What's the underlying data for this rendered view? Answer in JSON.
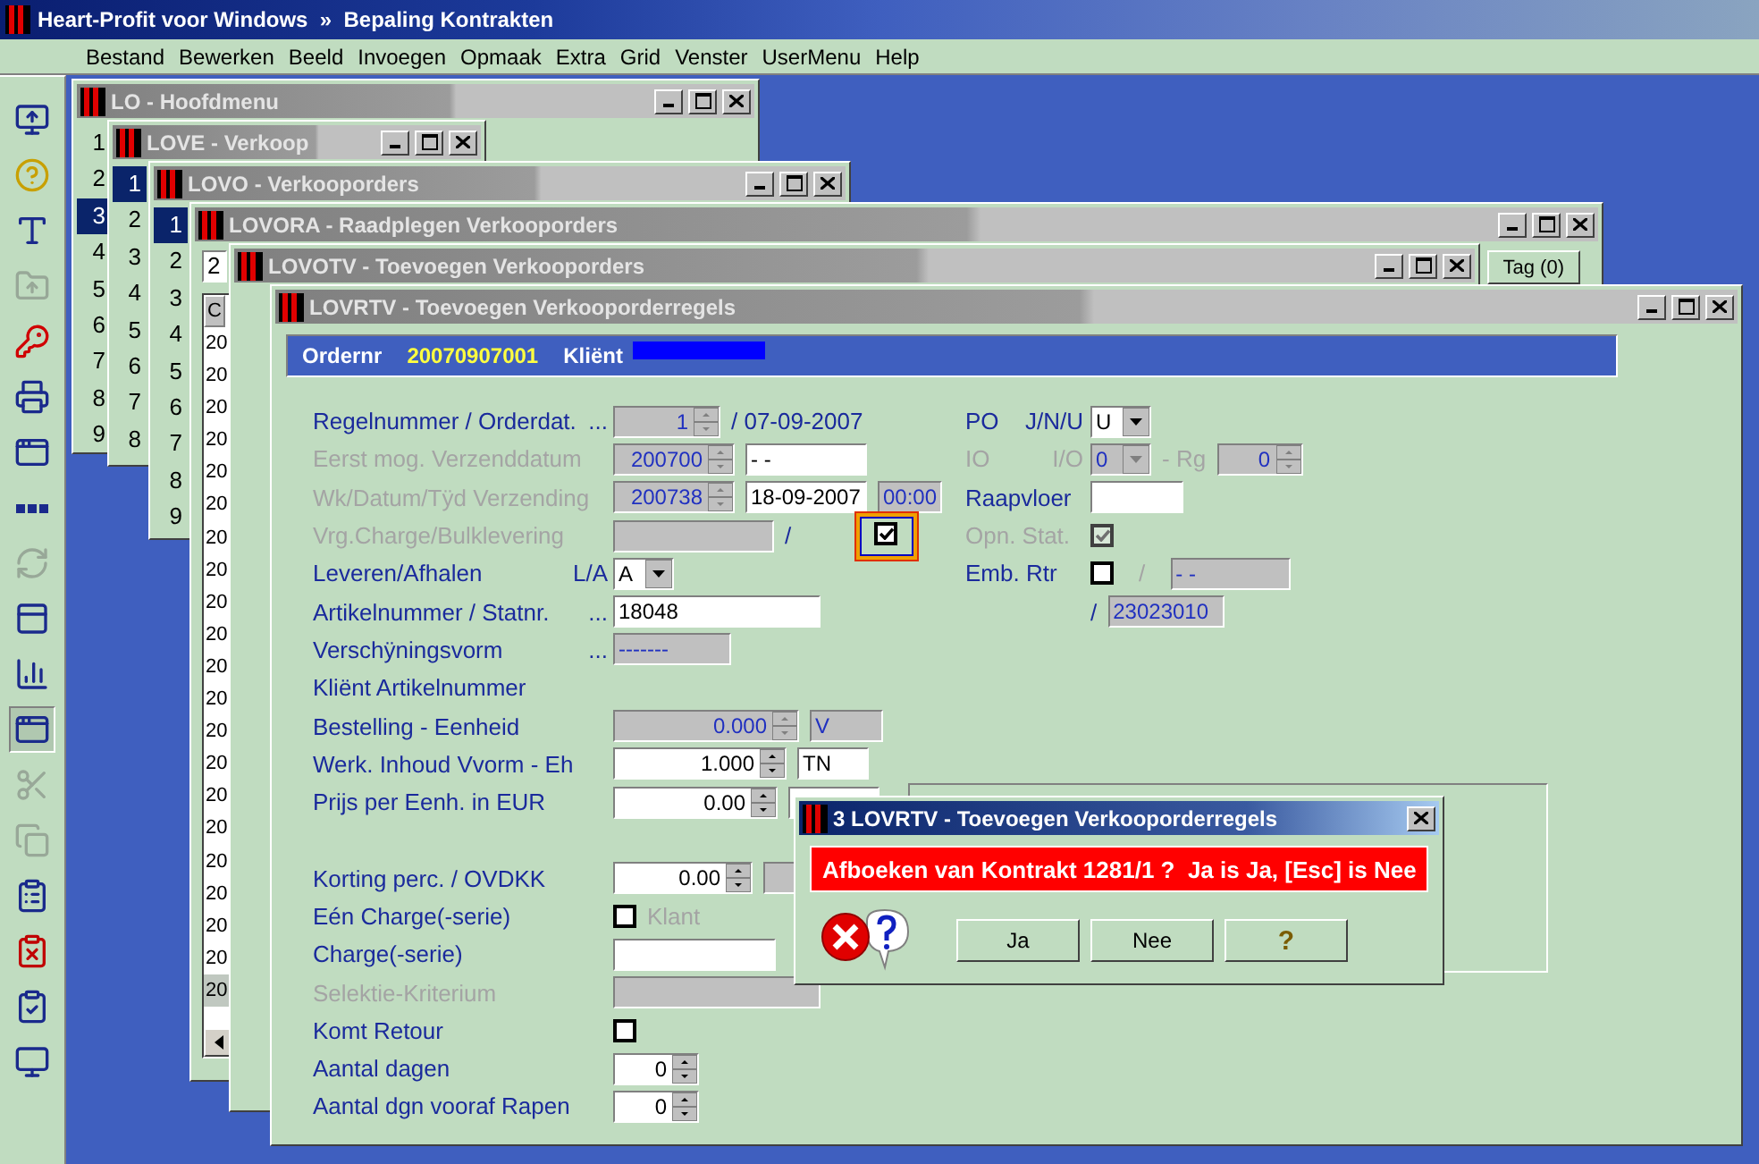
{
  "app_title": "Heart-Profit voor Windows  »  Bepaling Kontrakten",
  "menu": [
    "Bestand",
    "Bewerken",
    "Beeld",
    "Invoegen",
    "Opmaak",
    "Extra",
    "Grid",
    "Venster",
    "UserMenu",
    "Help"
  ],
  "toolbar": [
    {
      "disabled": false,
      "pressed": false
    },
    {
      "disabled": false,
      "pressed": false
    },
    {
      "disabled": false,
      "pressed": false
    },
    {
      "disabled": true,
      "pressed": false
    },
    {
      "disabled": false,
      "pressed": false
    },
    {
      "disabled": false,
      "pressed": false
    },
    {
      "disabled": false,
      "pressed": false
    },
    {
      "disabled": false,
      "pressed": false
    },
    {
      "disabled": true,
      "pressed": false
    },
    {
      "disabled": false,
      "pressed": false
    },
    {
      "disabled": false,
      "pressed": false
    },
    {
      "disabled": false,
      "pressed": true
    },
    {
      "disabled": true,
      "pressed": false
    },
    {
      "disabled": true,
      "pressed": false
    },
    {
      "disabled": false,
      "pressed": false
    },
    {
      "disabled": false,
      "pressed": false
    },
    {
      "disabled": false,
      "pressed": false
    },
    {
      "disabled": false,
      "pressed": false
    }
  ],
  "windows": [
    {
      "kind": "menu",
      "title": "LO - Hoofdmenu",
      "items": [
        {
          "label": "1",
          "selected": false
        },
        {
          "label": "2",
          "selected": false
        },
        {
          "label": "3",
          "selected": true
        },
        {
          "label": "4",
          "selected": false
        },
        {
          "label": "5",
          "selected": false
        },
        {
          "label": "6",
          "selected": false
        },
        {
          "label": "7",
          "selected": false
        },
        {
          "label": "8",
          "selected": false
        },
        {
          "label": "9",
          "selected": false
        }
      ]
    },
    {
      "kind": "menu",
      "title": "LOVE - Verkoop",
      "items": [
        {
          "label": "1",
          "selected": true
        },
        {
          "label": "2",
          "selected": false
        },
        {
          "label": "3",
          "selected": false
        },
        {
          "label": "4",
          "selected": false
        },
        {
          "label": "5",
          "selected": false
        },
        {
          "label": "6",
          "selected": false
        },
        {
          "label": "7",
          "selected": false
        },
        {
          "label": "8",
          "selected": false
        }
      ]
    },
    {
      "kind": "menu",
      "title": "LOVO - Verkooporders",
      "items": [
        {
          "label": "1",
          "selected": true
        },
        {
          "label": "2",
          "selected": false
        },
        {
          "label": "3",
          "selected": false
        },
        {
          "label": "4",
          "selected": false
        },
        {
          "label": "5",
          "selected": false
        },
        {
          "label": "6",
          "selected": false
        },
        {
          "label": "7",
          "selected": false
        },
        {
          "label": "8",
          "selected": false
        },
        {
          "label": "9",
          "selected": false
        }
      ]
    },
    {
      "kind": "browse",
      "title": "LOVORA - Raadplegen Verkooporders",
      "field": "2",
      "button": "Tag (0)",
      "column": "C",
      "rows": [
        {
          "value": "20",
          "selected": false
        },
        {
          "value": "20",
          "selected": false
        },
        {
          "value": "20",
          "selected": false
        },
        {
          "value": "20",
          "selected": false
        },
        {
          "value": "20",
          "selected": false
        },
        {
          "value": "20",
          "selected": false
        },
        {
          "value": "20",
          "selected": false
        },
        {
          "value": "20",
          "selected": false
        },
        {
          "value": "20",
          "selected": false
        },
        {
          "value": "20",
          "selected": false
        },
        {
          "value": "20",
          "selected": false
        },
        {
          "value": "20",
          "selected": false
        },
        {
          "value": "20",
          "selected": false
        },
        {
          "value": "20",
          "selected": false
        },
        {
          "value": "20",
          "selected": false
        },
        {
          "value": "20",
          "selected": false
        },
        {
          "value": "20",
          "selected": false
        },
        {
          "value": "20",
          "selected": false
        },
        {
          "value": "20",
          "selected": false
        },
        {
          "value": "20",
          "selected": false
        },
        {
          "value": "20",
          "selected": true
        }
      ]
    },
    {
      "kind": "blank",
      "title": "LOVOTV - Toevoegen Verkooporders"
    },
    {
      "kind": "form",
      "title": "LOVRTV - Toevoegen Verkooporderregels",
      "header": {
        "order_label": "Ordernr",
        "order_number": "20070907001",
        "client_label": "Kliënt"
      },
      "rows": [
        {
          "label": "Regelnummer / Orderdat.",
          "disabled": false,
          "suffix": "...",
          "controls": [
            {
              "kind": "spinner",
              "value": "1",
              "disabled": true
            },
            {
              "kind": "text",
              "value": "/ 07-09-2007",
              "disabled": false
            }
          ]
        },
        {
          "label": "Eerst mog. Verzenddatum",
          "disabled": true,
          "controls": [
            {
              "kind": "spinner",
              "value": "200700",
              "disabled": true
            },
            {
              "kind": "input",
              "value": "- -",
              "disabled": false
            }
          ]
        },
        {
          "label": "Wk/Datum/Tÿd Verzending",
          "disabled": true,
          "controls": [
            {
              "kind": "spinner",
              "value": "200738",
              "disabled": true
            },
            {
              "kind": "input",
              "value": "18-09-2007",
              "disabled": false
            },
            {
              "kind": "input",
              "value": "00:00",
              "disabled": true
            }
          ]
        },
        {
          "label": "Vrg.Charge/Bulklevering",
          "disabled": true,
          "controls": [
            {
              "kind": "input",
              "disabled": true
            },
            {
              "kind": "text",
              "value": "/",
              "disabled": false
            },
            {
              "kind": "checkbox",
              "checked": true,
              "disabled": false,
              "focused": true
            }
          ]
        },
        {
          "label": "Leveren/Afhalen",
          "disabled": false,
          "suffix": "L/A",
          "controls": [
            {
              "kind": "combo",
              "value": "A",
              "disabled": false
            }
          ]
        },
        {
          "label": "Artikelnummer / Statnr.",
          "disabled": false,
          "suffix": "...",
          "controls": [
            {
              "kind": "input",
              "value": "18048",
              "disabled": false
            }
          ]
        },
        {
          "label": "Verschÿningsvorm",
          "disabled": false,
          "suffix": "...",
          "controls": [
            {
              "kind": "input",
              "value": "-------",
              "disabled": true
            }
          ]
        },
        {
          "label": "Kliënt Artikelnummer",
          "disabled": false,
          "controls": []
        },
        {
          "label": "Bestelling - Eenheid",
          "disabled": false,
          "controls": [
            {
              "kind": "spinner",
              "value": "0.000",
              "disabled": true
            },
            {
              "kind": "input",
              "value": "V",
              "disabled": true
            }
          ]
        },
        {
          "label": "Werk. Inhoud Vvorm - Eh",
          "disabled": false,
          "controls": [
            {
              "kind": "spinner",
              "value": "1.000",
              "disabled": false
            },
            {
              "kind": "input",
              "value": "TN",
              "disabled": false
            }
          ]
        },
        {
          "label": "Prijs per Eenh. in EUR",
          "disabled": false,
          "controls": [
            {
              "kind": "spinner",
              "value": "0.00",
              "disabled": false
            },
            {
              "kind": "input",
              "disabled": false
            }
          ]
        },
        {
          "label": "Korting perc. / OVDKK",
          "disabled": false,
          "controls": [
            {
              "kind": "spinner",
              "value": "0.00",
              "disabled": false
            },
            {
              "kind": "input",
              "disabled": true
            }
          ]
        },
        {
          "label": "Eén Charge(-serie)",
          "disabled": false,
          "controls": [
            {
              "kind": "checkbox",
              "checked": false,
              "disabled": false
            },
            {
              "kind": "text",
              "value": "Klant",
              "disabled": true
            }
          ]
        },
        {
          "label": "Charge(-serie)",
          "disabled": false,
          "controls": [
            {
              "kind": "input",
              "disabled": false
            }
          ]
        },
        {
          "label": "Selektie-Kriterium",
          "disabled": true,
          "controls": [
            {
              "kind": "input",
              "disabled": true
            }
          ]
        },
        {
          "label": "Komt Retour",
          "disabled": false,
          "controls": [
            {
              "kind": "checkbox",
              "checked": false,
              "disabled": false
            }
          ]
        },
        {
          "label": "Aantal dagen",
          "disabled": false,
          "controls": [
            {
              "kind": "spinner",
              "value": "0",
              "disabled": false
            }
          ]
        },
        {
          "label": "Aantal dgn vooraf Rapen",
          "disabled": false,
          "controls": [
            {
              "kind": "spinner",
              "value": "0",
              "disabled": false
            }
          ]
        }
      ],
      "side_rows": [
        {
          "label": "PO",
          "sublabel": "J/N/U",
          "disabled": false,
          "controls": [
            {
              "kind": "combo",
              "value": "U",
              "disabled": false
            }
          ]
        },
        {
          "label": "IO",
          "sublabel": "I/O",
          "disabled": true,
          "controls": [
            {
              "kind": "combo",
              "value": "0",
              "disabled": true
            },
            {
              "kind": "text",
              "value": "- Rg",
              "disabled": true
            },
            {
              "kind": "spinner",
              "value": "0",
              "disabled": true
            }
          ]
        },
        {
          "label": "Raapvloer",
          "disabled": false,
          "controls": [
            {
              "kind": "input",
              "disabled": false
            }
          ]
        },
        {
          "label": "Opn. Stat.",
          "disabled": true,
          "controls": [
            {
              "kind": "checkbox",
              "checked": true,
              "disabled": true
            }
          ]
        },
        {
          "label": "Emb. Rtr",
          "disabled": false,
          "controls": [
            {
              "kind": "checkbox",
              "checked": false,
              "disabled": false
            },
            {
              "kind": "text",
              "value": "/",
              "disabled": true
            },
            {
              "kind": "input",
              "value": "- -",
              "disabled": true
            }
          ]
        },
        {
          "controls": [
            {
              "kind": "text",
              "value": "/",
              "disabled": false
            },
            {
              "kind": "input",
              "value": "23023010",
              "disabled": true
            }
          ]
        }
      ]
    }
  ],
  "dialog": {
    "title": "3 LOVRTV - Toevoegen Verkooporderregels",
    "message": "Afboeken van Kontrakt 1281/1 ?  Ja is Ja, [Esc] is Nee",
    "buttons": [
      "Ja",
      "Nee",
      "?"
    ]
  }
}
